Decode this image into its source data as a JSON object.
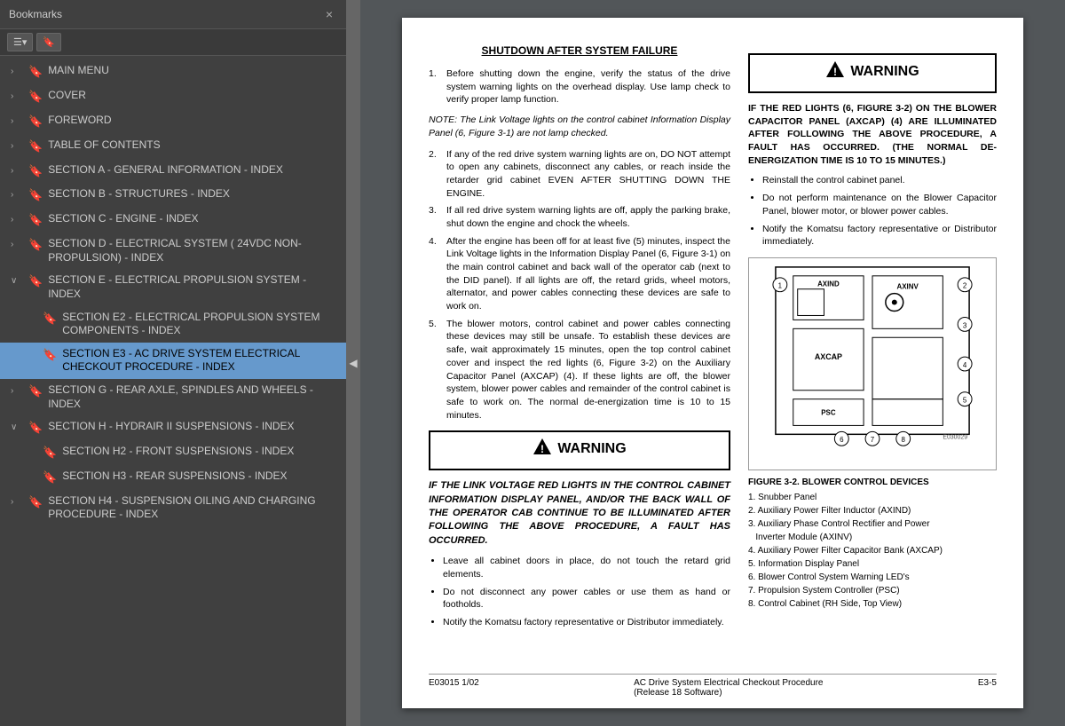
{
  "bookmarks": {
    "title": "Bookmarks",
    "close_label": "×",
    "toolbar": {
      "btn1_label": "☰▾",
      "btn2_label": "🔖"
    },
    "items": [
      {
        "id": "main-menu",
        "label": "MAIN MENU",
        "indent": 0,
        "expanded": false,
        "active": false
      },
      {
        "id": "cover",
        "label": "COVER",
        "indent": 0,
        "expanded": false,
        "active": false
      },
      {
        "id": "foreword",
        "label": "FOREWORD",
        "indent": 0,
        "expanded": false,
        "active": false
      },
      {
        "id": "toc",
        "label": "TABLE OF CONTENTS",
        "indent": 0,
        "expanded": false,
        "active": false
      },
      {
        "id": "section-a",
        "label": "SECTION A - GENERAL INFORMATION - INDEX",
        "indent": 0,
        "expanded": false,
        "active": false
      },
      {
        "id": "section-b",
        "label": "SECTION B - STRUCTURES - INDEX",
        "indent": 0,
        "expanded": false,
        "active": false
      },
      {
        "id": "section-c",
        "label": "SECTION C - ENGINE - INDEX",
        "indent": 0,
        "expanded": false,
        "active": false
      },
      {
        "id": "section-d",
        "label": "SECTION D - ELECTRICAL SYSTEM ( 24VDC NON-PROPULSION) - INDEX",
        "indent": 0,
        "expanded": false,
        "active": false
      },
      {
        "id": "section-e",
        "label": "SECTION E - ELECTRICAL PROPULSION SYSTEM - INDEX",
        "indent": 0,
        "expanded": true,
        "active": false
      },
      {
        "id": "section-e2",
        "label": "SECTION E2 - ELECTRICAL PROPULSION SYSTEM COMPONENTS - INDEX",
        "indent": 1,
        "expanded": false,
        "active": false
      },
      {
        "id": "section-e3",
        "label": "SECTION E3 - AC DRIVE SYSTEM ELECTRICAL CHECKOUT PROCEDURE - INDEX",
        "indent": 1,
        "expanded": false,
        "active": true
      },
      {
        "id": "section-g",
        "label": "SECTION G - REAR AXLE, SPINDLES AND WHEELS - INDEX",
        "indent": 0,
        "expanded": false,
        "active": false
      },
      {
        "id": "section-h",
        "label": "SECTION H - HYDRAIR II SUSPENSIONS - INDEX",
        "indent": 0,
        "expanded": true,
        "active": false
      },
      {
        "id": "section-h2",
        "label": "SECTION H2 - FRONT SUSPENSIONS - INDEX",
        "indent": 1,
        "expanded": false,
        "active": false
      },
      {
        "id": "section-h3",
        "label": "SECTION H3 - REAR SUSPENSIONS - INDEX",
        "indent": 1,
        "expanded": false,
        "active": false
      },
      {
        "id": "section-h4",
        "label": "SECTION H4 - SUSPENSION OILING AND CHARGING PROCEDURE - INDEX",
        "indent": 0,
        "expanded": false,
        "active": false
      }
    ]
  },
  "document": {
    "section_title": "SHUTDOWN AFTER SYSTEM FAILURE",
    "step1": "Before shutting down the engine, verify the status of the drive system warning lights on the overhead display. Use lamp check to verify proper lamp function.",
    "note": "NOTE: The Link Voltage lights on the control cabinet Information Display Panel (6, Figure 3-1) are not lamp checked.",
    "step2": "If any of the red drive system warning lights are on, DO NOT attempt to open any cabinets, disconnect any cables, or reach inside the retarder grid cabinet EVEN AFTER SHUTTING DOWN THE ENGINE.",
    "step3": "If all red drive system warning lights are off, apply the parking brake, shut down the engine and chock the wheels.",
    "step4": "After the engine has been off for at least five (5) minutes, inspect the Link Voltage lights in the Information Display Panel (6, Figure 3-1) on the main control cabinet and back wall of the operator cab (next to the DID panel). If all lights are off, the retard grids, wheel motors, alternator, and power cables connecting these devices are safe to work on.",
    "step5": "The blower motors, control cabinet and power cables connecting these devices may still be unsafe. To establish these devices are safe, wait approximately 15 minutes, open the top control cabinet cover and inspect the red lights (6, Figure 3-2) on the Auxiliary Capacitor Panel (AXCAP) (4). If these lights are off, the blower system, blower power cables and remainder of the control cabinet is safe to work on. The normal de-energization time is 10 to 15 minutes.",
    "warning1_title": "WARNING",
    "warning1_text": "IF THE RED LIGHTS (6, FIGURE 3-2) ON THE BLOWER CAPACITOR PANEL (AXCAP) (4) ARE ILLUMINATED AFTER FOLLOWING THE ABOVE PROCEDURE, A FAULT HAS OCCURRED. (THE NORMAL DE-ENERGIZATION TIME IS 10 TO 15 MINUTES.)",
    "warning1_bullets": [
      "Reinstall the control cabinet panel.",
      "Do not perform maintenance on the Blower Capacitor Panel, blower motor, or blower power cables.",
      "Notify the Komatsu factory representative or Distributor immediately."
    ],
    "warning2_title": "WARNING",
    "warning2_text": "IF THE LINK VOLTAGE RED LIGHTS IN THE CONTROL CABINET INFORMATION DISPLAY PANEL, AND/OR THE BACK WALL OF THE OPERATOR CAB CONTINUE TO BE ILLUMINATED AFTER FOLLOWING THE ABOVE PROCEDURE, A FAULT HAS OCCURRED.",
    "warning2_bullets": [
      "Leave all cabinet doors in place, do not touch the retard grid elements.",
      "Do not disconnect any power cables or use them as hand or footholds.",
      "Notify the Komatsu factory representative or Distributor immediately."
    ],
    "figure_caption": "FIGURE 3-2. BLOWER CONTROL DEVICES",
    "figure_items": [
      "1. Snubber Panel",
      "2. Auxiliary Power Filter Inductor (AXIND)",
      "3. Auxiliary Phase Control Rectifier and Power Inverter Module (AXINV)",
      "4. Auxiliary Power Filter Capacitor Bank (AXCAP)",
      "5. Information Display Panel",
      "6. Blower Control System Warning LED's",
      "7. Propulsion System Controller (PSC)",
      "8. Control Cabinet (RH Side, Top View)"
    ],
    "footer_left": "E03015 1/02",
    "footer_center": "AC Drive System Electrical Checkout Procedure\n(Release 18 Software)",
    "footer_right": "E3-5"
  }
}
